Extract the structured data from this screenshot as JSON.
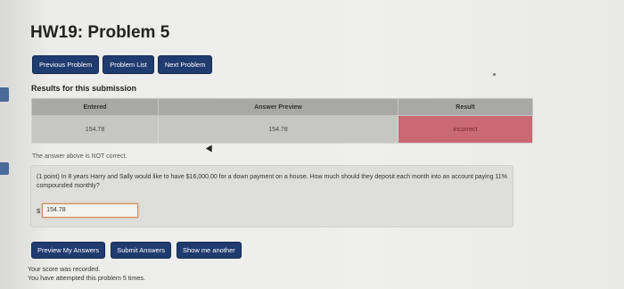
{
  "title": "HW19: Problem 5",
  "nav": {
    "previous": "Previous Problem",
    "list": "Problem List",
    "next": "Next Problem"
  },
  "results": {
    "heading": "Results for this submission",
    "headers": [
      "Entered",
      "Answer Preview",
      "Result"
    ],
    "row": {
      "entered": "154.78",
      "preview": "154.78",
      "result": "incorrect"
    }
  },
  "status_text": "The answer above is NOT correct.",
  "problem": {
    "text": "(1 point) In 8 years Harry and Sally would like to have $16,000.00 for a down payment on a house. How much should they deposit each month into an account paying 11% compounded monthly?",
    "currency": "$",
    "answer_value": "154.78"
  },
  "actions": {
    "preview": "Preview My Answers",
    "submit": "Submit Answers",
    "show": "Show me another"
  },
  "score": {
    "line1": "Your score was recorded.",
    "line2": "You have attempted this problem 5 times."
  },
  "colors": {
    "button": "#1f3b6f",
    "incorrect": "#c96a72"
  }
}
